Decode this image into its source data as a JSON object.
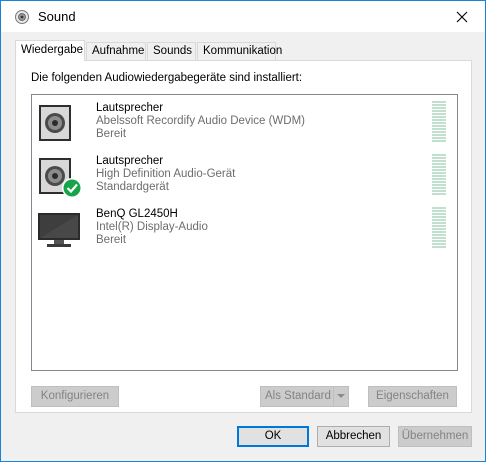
{
  "window": {
    "title": "Sound",
    "title_icon": "speaker-icon",
    "close_icon": "close-icon"
  },
  "tabs": [
    {
      "label": "Wiedergabe",
      "active": true
    },
    {
      "label": "Aufnahme",
      "active": false
    },
    {
      "label": "Sounds",
      "active": false
    },
    {
      "label": "Kommunikation",
      "active": false
    }
  ],
  "intro_text": "Die folgenden Audiowiedergabegeräte sind installiert:",
  "devices": [
    {
      "name": "Lautsprecher",
      "description": "Abelssoft Recordify Audio Device (WDM)",
      "status": "Bereit",
      "icon": "speaker-device-icon",
      "default": false
    },
    {
      "name": "Lautsprecher",
      "description": "High Definition Audio-Gerät",
      "status": "Standardgerät",
      "icon": "speaker-device-icon",
      "default": true
    },
    {
      "name": "BenQ GL2450H",
      "description": "Intel(R) Display-Audio",
      "status": "Bereit",
      "icon": "monitor-device-icon",
      "default": false
    }
  ],
  "buttons": {
    "configure": "Konfigurieren",
    "set_default": "Als Standard",
    "properties": "Eigenschaften",
    "ok": "OK",
    "cancel": "Abbrechen",
    "apply": "Übernehmen"
  },
  "colors": {
    "accent": "#0078d7",
    "check": "#16a34a",
    "meter": "#c2e0d0"
  }
}
